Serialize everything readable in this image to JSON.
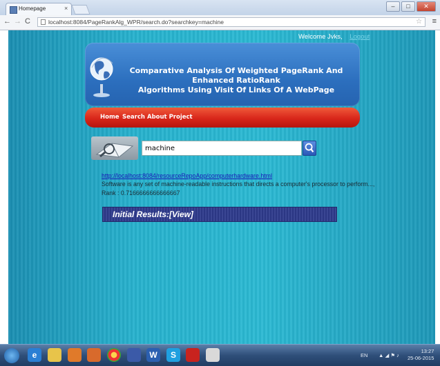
{
  "browser": {
    "tab_title": "Homepage",
    "tab_close": "×",
    "url": "localhost:8084/PageRankAlg_WPR/search.do?searchkey=machine",
    "window_buttons": [
      "–",
      "□",
      "✕"
    ]
  },
  "header": {
    "welcome": "Welcome Jvks,",
    "logout": "Logout"
  },
  "banner": {
    "title_line1": "Comparative Analysis Of Weighted PageRank And Enhanced RatioRank",
    "title_line2": "Algorithms Using Visit Of Links Of A WebPage"
  },
  "nav": {
    "items": [
      "Home",
      "Search",
      "About Project"
    ]
  },
  "search": {
    "value": "machine"
  },
  "result": {
    "link": "http://localhost:8084/resourceRepoApp/computerhardware.html",
    "description": "Software is any set of machine-readable instructions that directs a computer's processor to perform...,",
    "rank": "Rank : 0.7166666666666667"
  },
  "initial_results": {
    "label": "Initial Results:[View]"
  },
  "taskbar": {
    "tray_lang": "EN",
    "time": "13:27",
    "date": "25-06-2015"
  },
  "colors": {
    "page_bg": "#27b2ce",
    "banner": "#2c6fbe",
    "navbar": "#d8261a",
    "results_bar": "#2e3a8c"
  }
}
